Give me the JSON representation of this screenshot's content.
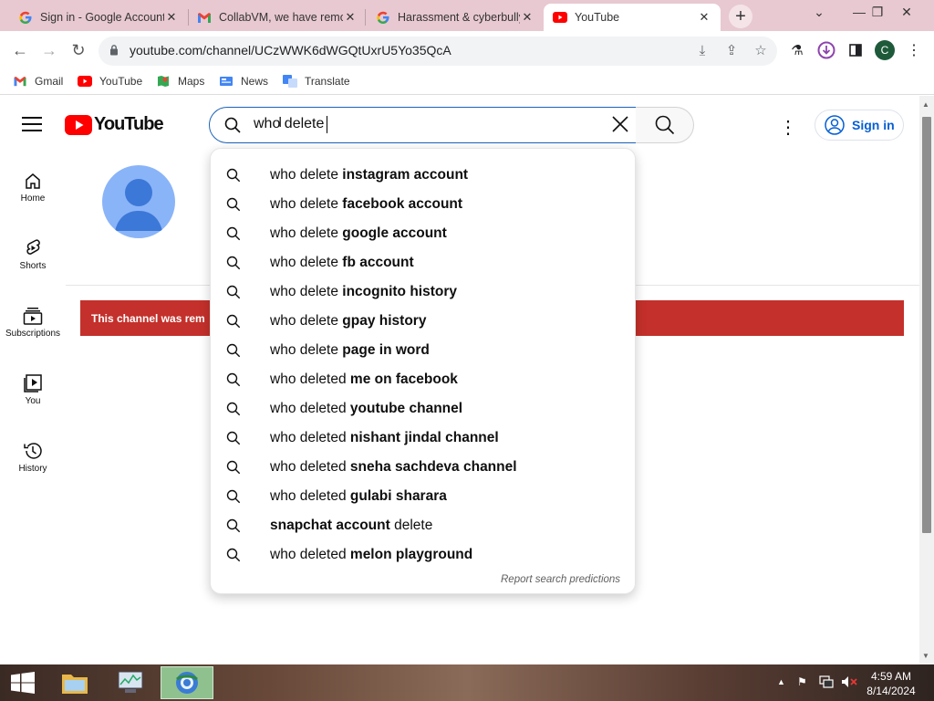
{
  "browser": {
    "tabs": [
      {
        "title": "Sign in - Google Accounts",
        "icon": "google-icon",
        "active": false
      },
      {
        "title": "CollabVM, we have removed",
        "icon": "gmail-icon",
        "active": false
      },
      {
        "title": "Harassment & cyberbullying",
        "icon": "google-icon",
        "active": false
      },
      {
        "title": "YouTube",
        "icon": "youtube-icon",
        "active": true
      }
    ],
    "url": "youtube.com/channel/UCzWWK6dWGQtUxrU5Yo35QcA",
    "profile_initial": "C",
    "bookmarks": [
      "Gmail",
      "YouTube",
      "Maps",
      "News",
      "Translate"
    ]
  },
  "youtube": {
    "logo_text": "YouTube",
    "search_value": "who delete ",
    "sign_in_label": "Sign in",
    "sidebar": [
      "Home",
      "Shorts",
      "Subscriptions",
      "You",
      "History"
    ],
    "banner_text": "This channel was rem",
    "suggestions": [
      {
        "prefix": "who delete ",
        "bold": "instagram account"
      },
      {
        "prefix": "who delete ",
        "bold": "facebook account"
      },
      {
        "prefix": "who delete ",
        "bold": "google account"
      },
      {
        "prefix": "who delete ",
        "bold": "fb account"
      },
      {
        "prefix": "who delete ",
        "bold": "incognito history"
      },
      {
        "prefix": "who delete ",
        "bold": "gpay history"
      },
      {
        "prefix": "who delete ",
        "bold": "page in word"
      },
      {
        "prefix": "who deleted ",
        "bold": "me on facebook"
      },
      {
        "prefix": "who deleted ",
        "bold": "youtube channel"
      },
      {
        "prefix": "who deleted ",
        "bold": "nishant jindal channel"
      },
      {
        "prefix": "who deleted ",
        "bold": "sneha sachdeva channel"
      },
      {
        "prefix": "who deleted ",
        "bold": "gulabi sharara"
      },
      {
        "prefix": "",
        "bold": "snapchat account",
        "suffix": " delete"
      },
      {
        "prefix": "who deleted ",
        "bold": "melon playground"
      }
    ],
    "report_label": "Report search predictions"
  },
  "taskbar": {
    "time": "4:59 AM",
    "date": "8/14/2024"
  },
  "colors": {
    "tabstrip": "#e8c9d1",
    "youtube_red": "#ff0000",
    "banner_red": "#c4302b",
    "link_blue": "#065fd4"
  }
}
